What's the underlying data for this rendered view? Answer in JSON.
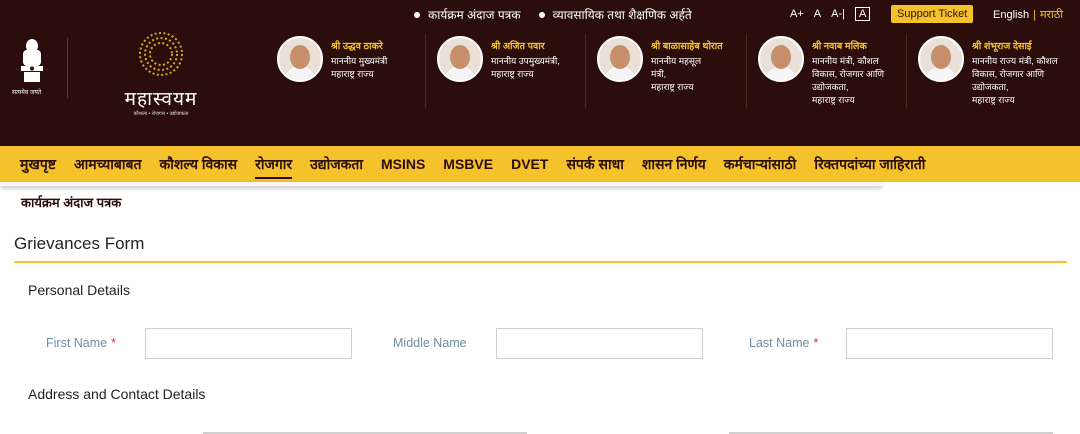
{
  "topbar": {
    "ticker": [
      "कार्यक्रम अंदाज पत्रक",
      "व्यावसायिक तथा शैक्षणिक अर्हते"
    ],
    "font_controls": {
      "increase": "A+",
      "normal": "A",
      "decrease": "A-",
      "separator": "|",
      "contrast": "A"
    },
    "support_label": "Support Ticket",
    "lang_english": "English",
    "lang_separator": "|",
    "lang_marathi": "मराठी"
  },
  "brand": {
    "emblem_caption": "सत्यमेव जयते",
    "logo_name": "महास्वयम",
    "logo_tagline": "कौशल्य • रोजगार • उद्योजकता"
  },
  "ministers": [
    {
      "name": "श्री उद्धव ठाकरे",
      "role": "माननीय मुख्यमंत्री\nमहाराष्ट्र राज्य"
    },
    {
      "name": "श्री अजित पवार",
      "role": "माननीय उपमुख्यमंत्री,\nमहाराष्ट्र राज्य"
    },
    {
      "name": "श्री बाळासाहेब थोरात",
      "role": "माननीय महसूल\nमंत्री,\nमहाराष्ट्र राज्य"
    },
    {
      "name": "श्री नवाब मलिक",
      "role": "माननीय मंत्री, कौशल\nविकास, रोजगार आणि\nउद्योजकता,\nमहाराष्ट्र राज्य"
    },
    {
      "name": "श्री शंभूराज देसाई",
      "role": "माननीय राज्य मंत्री, कौशल\nविकास, रोजगार आणि\nउद्योजकता,\nमहाराष्ट्र राज्य"
    }
  ],
  "nav": [
    "मुखपृष्ट",
    "आमच्याबाबत",
    "कौशल्य विकास",
    "रोजगार",
    "उद्योजकता",
    "MSINS",
    "MSBVE",
    "DVET",
    "संपर्क साधा",
    "शासन निर्णय",
    "कर्मचाऱ्यांसाठी",
    "रिक्तपदांच्या जाहिराती"
  ],
  "nav_active_index": 3,
  "submenu_item": "कार्यक्रम अंदाज पत्रक",
  "form": {
    "title": "Grievances Form",
    "personal_section": "Personal Details",
    "first_name_label": "First Name",
    "middle_name_label": "Middle Name",
    "last_name_label": "Last Name",
    "required_mark": "*",
    "address_section": "Address and Contact Details"
  },
  "colors": {
    "header_bg": "#2b0e0b",
    "accent": "#f5c22b",
    "label": "#6e8fa0",
    "required": "#e0322c"
  }
}
